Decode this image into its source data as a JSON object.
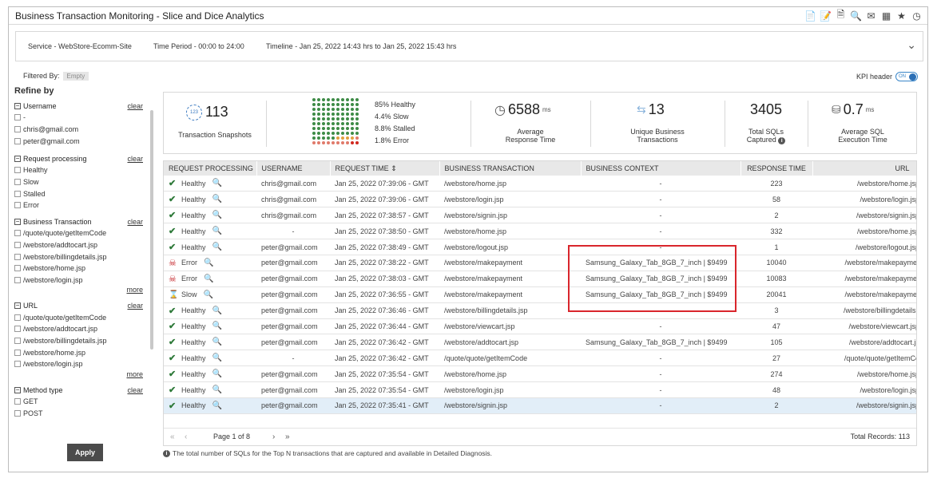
{
  "window": {
    "title": "Business Transaction Monitoring - Slice and Dice Analytics",
    "toolbar_icons": [
      "report-icon",
      "edit-report-icon",
      "export-icon",
      "search-settings-icon",
      "mail-icon",
      "excel-icon",
      "star-icon",
      "timer-icon"
    ]
  },
  "infobar": {
    "service_label": "Service",
    "service_value": "WebStore-Ecomm-Site",
    "period_label": "Time Period",
    "period_value": "00:00 to 24:00",
    "timeline_label": "Timeline",
    "timeline_value": "Jan 25, 2022 14:43 hrs to Jan 25, 2022 15:43 hrs"
  },
  "filters": {
    "label": "Filtered By:",
    "value": "Empty",
    "kpi_header_label": "KPI header",
    "kpi_toggle": "ON"
  },
  "sidebar": {
    "title": "Refine by",
    "clear_label": "clear",
    "more_label": "more",
    "apply_label": "Apply",
    "groups": {
      "username": {
        "name": "Username",
        "options": [
          "-",
          "chris@gmail.com",
          "peter@gmail.com"
        ]
      },
      "processing": {
        "name": "Request processing",
        "options": [
          "Healthy",
          "Slow",
          "Stalled",
          "Error"
        ]
      },
      "bt": {
        "name": "Business Transaction",
        "options": [
          "/quote/quote/getItemCode",
          "/webstore/addtocart.jsp",
          "/webstore/billingdetails.jsp",
          "/webstore/home.jsp",
          "/webstore/login.jsp"
        ]
      },
      "url": {
        "name": "URL",
        "options": [
          "/quote/quote/getItemCode",
          "/webstore/addtocart.jsp",
          "/webstore/billingdetails.jsp",
          "/webstore/home.jsp",
          "/webstore/login.jsp"
        ]
      },
      "method": {
        "name": "Method type",
        "options": [
          "GET",
          "POST"
        ]
      }
    }
  },
  "kpi": {
    "snapshots": {
      "value": "113",
      "caption": "Transaction Snapshots",
      "icon_text": "123"
    },
    "health": {
      "healthy": "85% Healthy",
      "slow": "4.4% Slow",
      "stalled": "8.8% Stalled",
      "error": "1.8% Error",
      "fractions": {
        "healthy": 0.85,
        "slow": 0.044,
        "stalled": 0.088,
        "error": 0.018
      }
    },
    "response": {
      "value": "6588",
      "unit": "ms",
      "caption1": "Average",
      "caption2": "Response Time"
    },
    "unique": {
      "value": "13",
      "caption1": "Unique Business",
      "caption2": "Transactions"
    },
    "sqls": {
      "value": "3405",
      "caption1": "Total SQLs",
      "caption2": "Captured"
    },
    "sqltime": {
      "value": "0.7",
      "unit": "ms",
      "caption1": "Average SQL",
      "caption2": "Execution Time"
    }
  },
  "colors": {
    "healthy": "#3d8b46",
    "slow": "#e0a040",
    "stalled": "#e07a6a",
    "error": "#d0281f",
    "highlight": "#d9262c",
    "selected_row": "#e2eef8"
  },
  "table": {
    "headers": {
      "processing": "REQUEST PROCESSING",
      "username": "USERNAME",
      "time": "REQUEST TIME",
      "bt": "BUSINESS TRANSACTION",
      "context": "BUSINESS CONTEXT",
      "response": "RESPONSE TIME",
      "url": "URL"
    },
    "rows": [
      {
        "status": "Healthy",
        "user": "chris@gmail.com",
        "time": "Jan 25, 2022 07:39:06 - GMT",
        "bt": "/webstore/home.jsp",
        "ctx": "-",
        "resp": "223",
        "url": "/webstore/home.jsp"
      },
      {
        "status": "Healthy",
        "user": "chris@gmail.com",
        "time": "Jan 25, 2022 07:39:06 - GMT",
        "bt": "/webstore/login.jsp",
        "ctx": "-",
        "resp": "58",
        "url": "/webstore/login.jsp"
      },
      {
        "status": "Healthy",
        "user": "chris@gmail.com",
        "time": "Jan 25, 2022 07:38:57 - GMT",
        "bt": "/webstore/signin.jsp",
        "ctx": "-",
        "resp": "2",
        "url": "/webstore/signin.jsp"
      },
      {
        "status": "Healthy",
        "user": "-",
        "time": "Jan 25, 2022 07:38:50 - GMT",
        "bt": "/webstore/home.jsp",
        "ctx": "-",
        "resp": "332",
        "url": "/webstore/home.jsp"
      },
      {
        "status": "Healthy",
        "user": "peter@gmail.com",
        "time": "Jan 25, 2022 07:38:49 - GMT",
        "bt": "/webstore/logout.jsp",
        "ctx": "-",
        "resp": "1",
        "url": "/webstore/logout.jsp"
      },
      {
        "status": "Error",
        "user": "peter@gmail.com",
        "time": "Jan 25, 2022 07:38:22 - GMT",
        "bt": "/webstore/makepayment",
        "ctx": "Samsung_Galaxy_Tab_8GB_7_inch | $9499",
        "resp": "10040",
        "url": "/webstore/makepaymer"
      },
      {
        "status": "Error",
        "user": "peter@gmail.com",
        "time": "Jan 25, 2022 07:38:03 - GMT",
        "bt": "/webstore/makepayment",
        "ctx": "Samsung_Galaxy_Tab_8GB_7_inch | $9499",
        "resp": "10083",
        "url": "/webstore/makepaymer"
      },
      {
        "status": "Slow",
        "user": "peter@gmail.com",
        "time": "Jan 25, 2022 07:36:55 - GMT",
        "bt": "/webstore/makepayment",
        "ctx": "Samsung_Galaxy_Tab_8GB_7_inch | $9499",
        "resp": "20041",
        "url": "/webstore/makepaymer"
      },
      {
        "status": "Healthy",
        "user": "peter@gmail.com",
        "time": "Jan 25, 2022 07:36:46 - GMT",
        "bt": "/webstore/billingdetails.jsp",
        "ctx": "",
        "resp": "3",
        "url": "/webstore/billingdetails.j"
      },
      {
        "status": "Healthy",
        "user": "peter@gmail.com",
        "time": "Jan 25, 2022 07:36:44 - GMT",
        "bt": "/webstore/viewcart.jsp",
        "ctx": "-",
        "resp": "47",
        "url": "/webstore/viewcart.jsp"
      },
      {
        "status": "Healthy",
        "user": "peter@gmail.com",
        "time": "Jan 25, 2022 07:36:42 - GMT",
        "bt": "/webstore/addtocart.jsp",
        "ctx": "Samsung_Galaxy_Tab_8GB_7_inch | $9499",
        "resp": "105",
        "url": "/webstore/addtocart.js"
      },
      {
        "status": "Healthy",
        "user": "-",
        "time": "Jan 25, 2022 07:36:42 - GMT",
        "bt": "/quote/quote/getItemCode",
        "ctx": "-",
        "resp": "27",
        "url": "/quote/quote/getItemCo"
      },
      {
        "status": "Healthy",
        "user": "peter@gmail.com",
        "time": "Jan 25, 2022 07:35:54 - GMT",
        "bt": "/webstore/home.jsp",
        "ctx": "-",
        "resp": "274",
        "url": "/webstore/home.jsp"
      },
      {
        "status": "Healthy",
        "user": "peter@gmail.com",
        "time": "Jan 25, 2022 07:35:54 - GMT",
        "bt": "/webstore/login.jsp",
        "ctx": "-",
        "resp": "48",
        "url": "/webstore/login.jsp"
      },
      {
        "status": "Healthy",
        "user": "peter@gmail.com",
        "time": "Jan 25, 2022 07:35:41 - GMT",
        "bt": "/webstore/signin.jsp",
        "ctx": "-",
        "resp": "2",
        "url": "/webstore/signin.jsp"
      }
    ]
  },
  "pager": {
    "page_text": "Page 1 of 8",
    "total_text": "Total Records: 113"
  },
  "footnote": "The total number of SQLs for the Top N transactions that are captured and available in Detailed Diagnosis."
}
